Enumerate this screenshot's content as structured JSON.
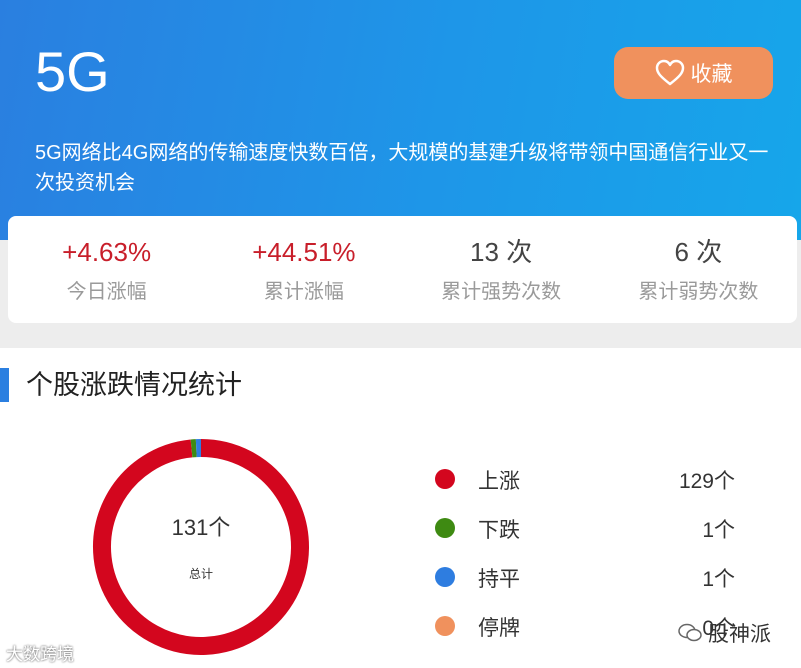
{
  "header": {
    "title": "5G",
    "favorite_label": "收藏",
    "description": "5G网络比4G网络的传输速度快数百倍，大规模的基建升级将带领中国通信行业又一次投资机会"
  },
  "stats": [
    {
      "value": "+4.63%",
      "label": "今日涨幅"
    },
    {
      "value": "+44.51%",
      "label": "累计涨幅"
    },
    {
      "value": "13 次",
      "label": "累计强势次数"
    },
    {
      "value": "6 次",
      "label": "累计弱势次数"
    }
  ],
  "section": {
    "title": "个股涨跌情况统计",
    "total": "131个",
    "total_label": "总计"
  },
  "legend": [
    {
      "label": "上涨",
      "count": "129个",
      "value": 129,
      "color": "#d3061e"
    },
    {
      "label": "下跌",
      "count": "1个",
      "value": 1,
      "color": "#3e8a12"
    },
    {
      "label": "持平",
      "count": "1个",
      "value": 1,
      "color": "#2e7de0"
    },
    {
      "label": "停牌",
      "count": "0个",
      "value": 0,
      "color": "#f0915d"
    }
  ],
  "watermarks": {
    "left": "大数跨境",
    "right": "股神派"
  },
  "colors": {
    "up": "#c81e2a",
    "accent": "#2b7fe0",
    "favorite": "#f0915d"
  }
}
